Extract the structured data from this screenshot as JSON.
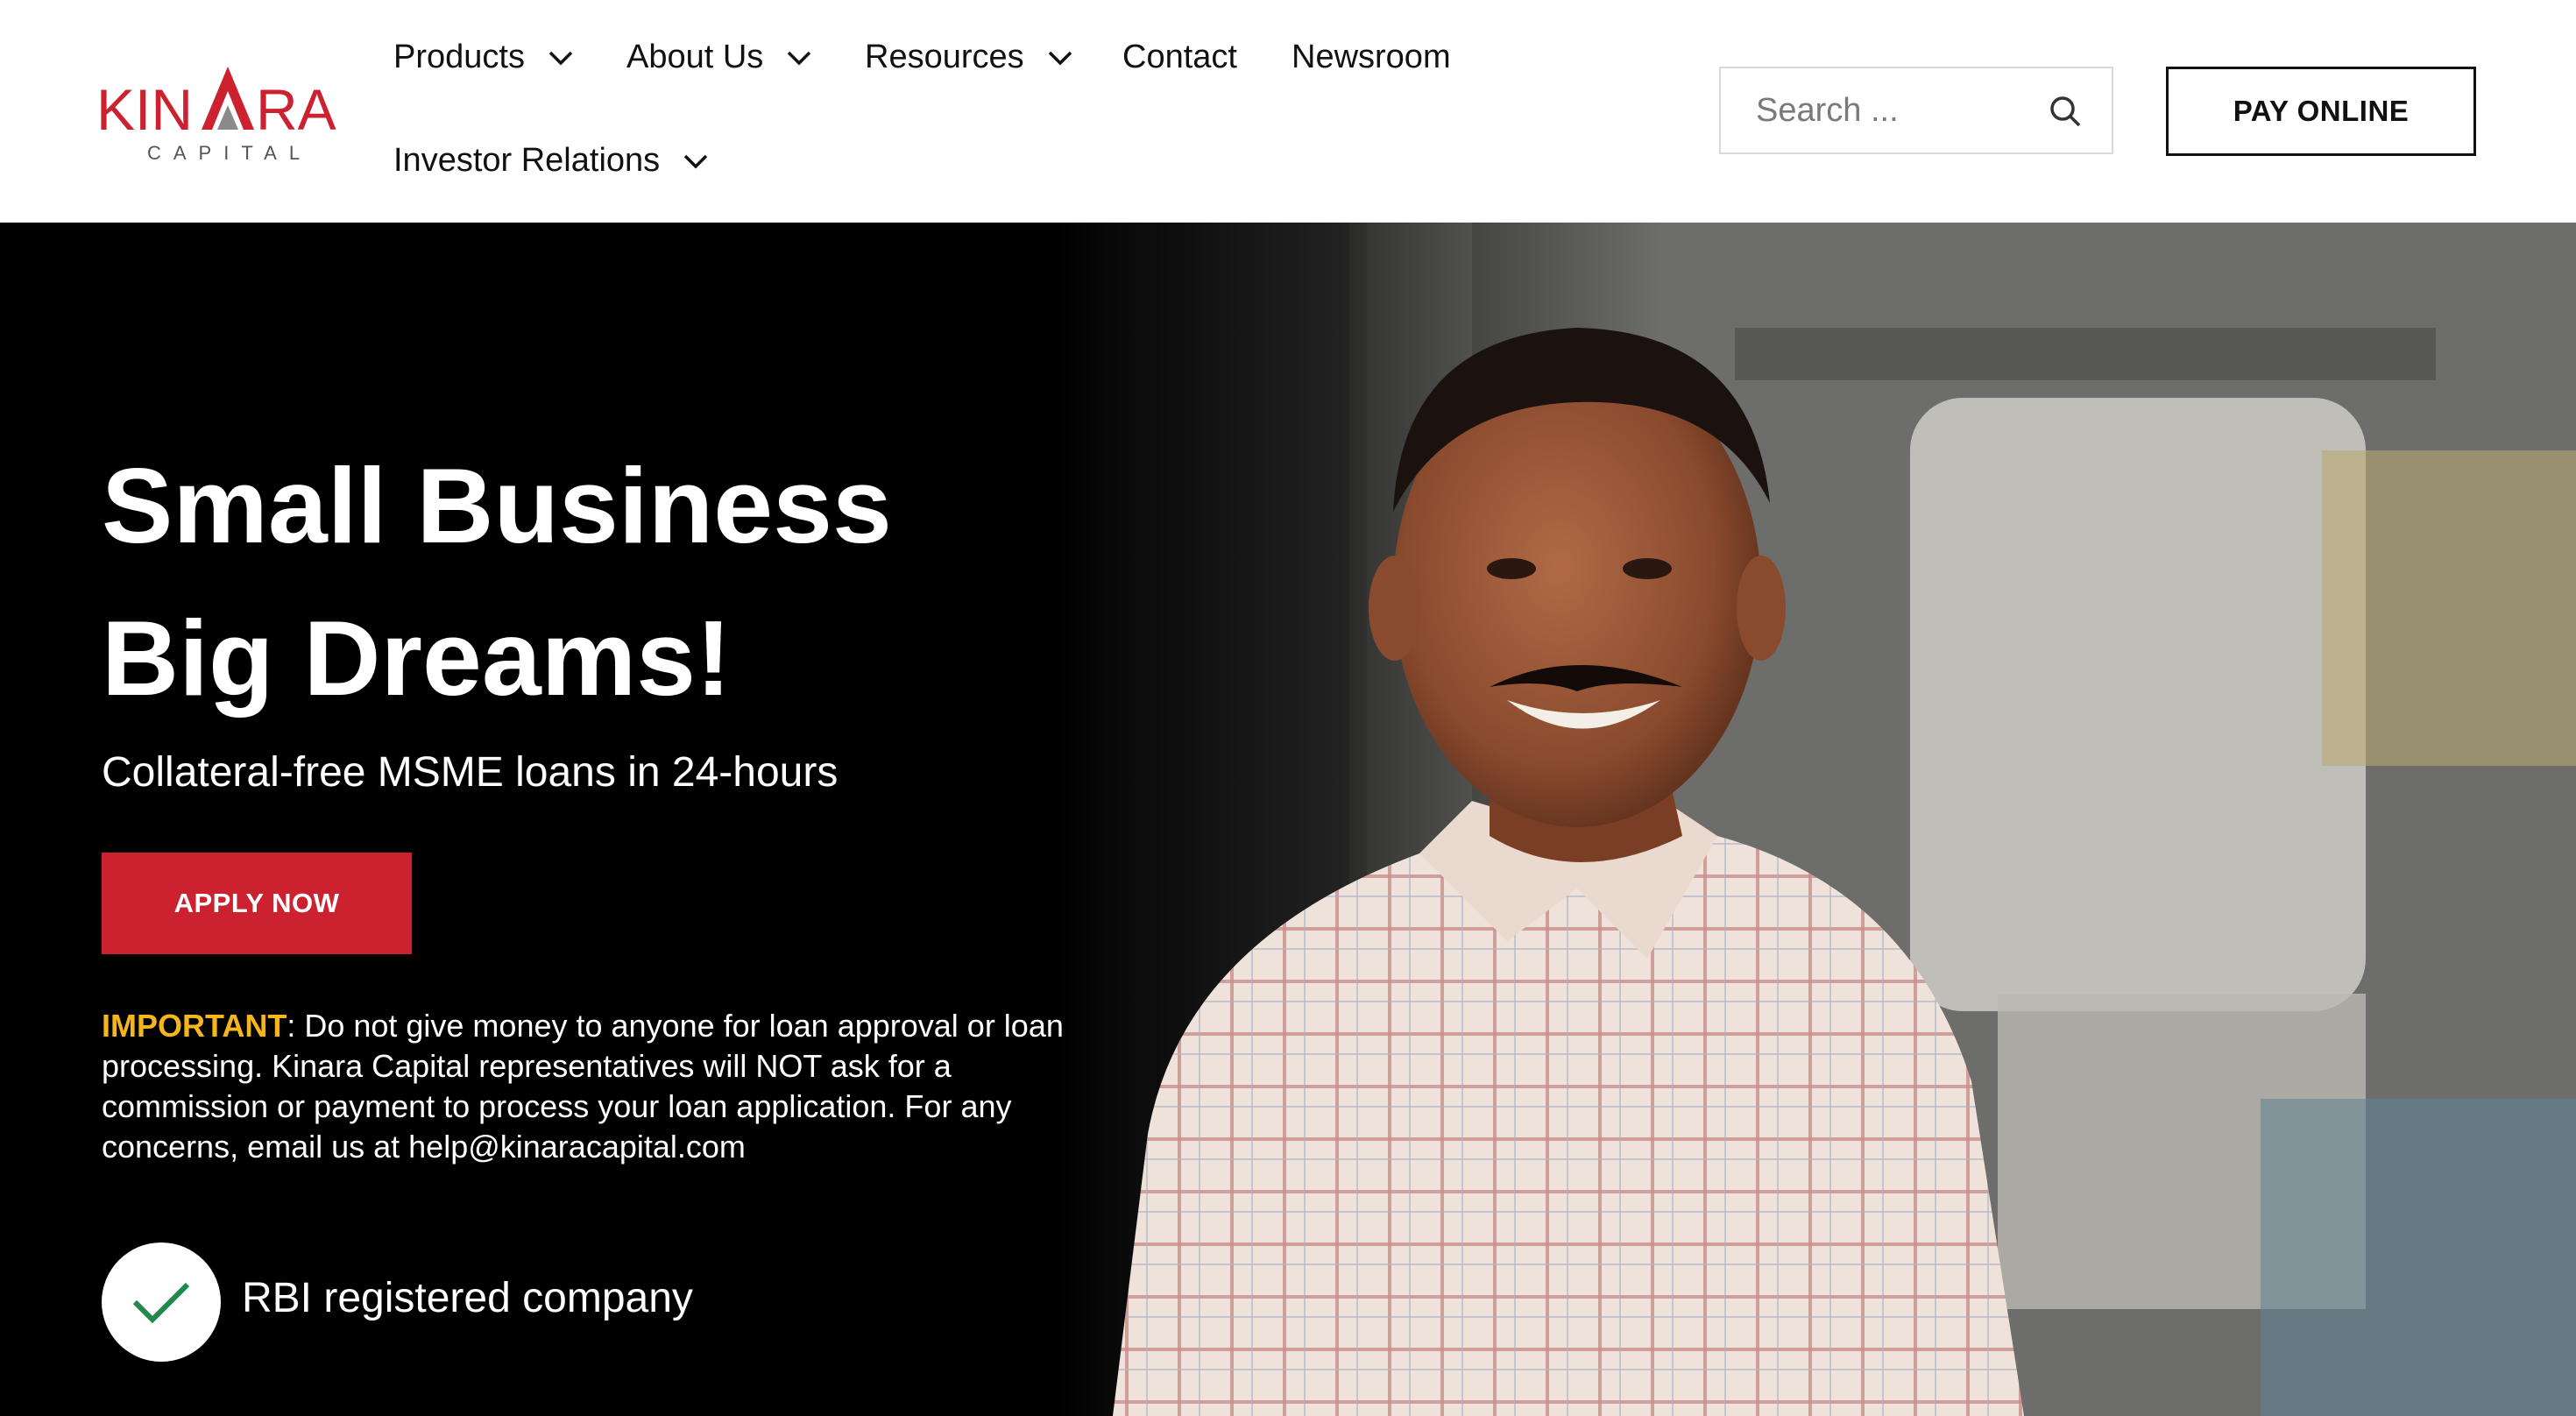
{
  "brand": {
    "name": "KINARA",
    "subtitle": "CAPITAL",
    "accent_color": "#cc2230",
    "logo_gray": "#8a8a8a"
  },
  "nav": {
    "items": [
      {
        "label": "Products",
        "has_dropdown": true
      },
      {
        "label": "About Us",
        "has_dropdown": true
      },
      {
        "label": "Resources",
        "has_dropdown": true
      },
      {
        "label": "Contact",
        "has_dropdown": false
      },
      {
        "label": "Newsroom",
        "has_dropdown": false
      },
      {
        "label": "Investor Relations",
        "has_dropdown": true
      }
    ],
    "icons": {
      "dropdown": "chevron-down-icon"
    }
  },
  "search": {
    "placeholder": "Search ...",
    "icon": "search-icon"
  },
  "header_cta": {
    "label": "PAY ONLINE"
  },
  "hero": {
    "title_line1": "Small Business",
    "title_line2": "Big Dreams!",
    "subtitle": "Collateral-free MSME loans in 24-hours",
    "apply_label": "APPLY NOW",
    "apply_color": "#cc2230",
    "notice_label": "IMPORTANT",
    "notice_label_color": "#f4b61a",
    "notice_text": ": Do not give money to anyone for loan approval or loan processing. Kinara Capital representatives will NOT ask for a commission or payment to process your loan application. For any concerns, email us at help@kinaracapital.com",
    "badge_icon": "checkmark-icon",
    "badge_color": "#1f8a4c",
    "badge_text": "RBI registered company",
    "photo": "smiling-man-in-checked-shirt-photo"
  }
}
